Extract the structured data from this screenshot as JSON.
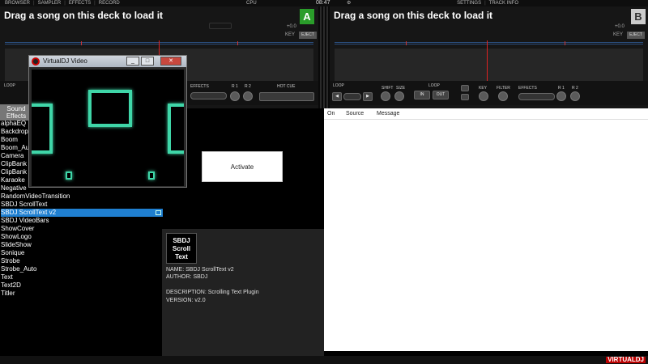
{
  "topbar": {
    "menu": [
      "BROWSER",
      "SAMPLER",
      "EFFECTS",
      "RECORD"
    ],
    "cpu_label": "CPU",
    "time": "08:47",
    "settings": "SETTINGS",
    "track_info": "TRACK INFO"
  },
  "deck_a": {
    "title": "Drag a song on this deck to load it",
    "letter": "A",
    "pitch": "+0.0",
    "key_label": "KEY",
    "eject": "EJECT"
  },
  "deck_b": {
    "title": "Drag a song on this deck to load it",
    "letter": "B",
    "pitch": "+0.0",
    "key_label": "KEY",
    "eject": "EJECT"
  },
  "controls_left": {
    "loop": "LOOP",
    "effects": "EFFECTS",
    "knob_r1": "R 1",
    "knob_r2": "R 2",
    "hot_cue": "HOT CUE"
  },
  "controls_right": {
    "loop": "LOOP",
    "shift": "SHIFT",
    "size": "SIZE",
    "loop2": "LOOP",
    "in": "IN",
    "out": "OUT",
    "key": "KEY",
    "filter": "FILTER",
    "effects": "EFFECTS",
    "knob_r1": "R 1",
    "knob_r2": "R 2"
  },
  "video_window": {
    "title": "VirtualDJ Video",
    "minimize": "_",
    "maximize": "□",
    "close": "✕"
  },
  "sidebar": {
    "sound_effects_line1": "Sound",
    "sound_effects_line2": "Effects"
  },
  "effects": [
    "alphaEQ",
    "Backdrop",
    "Boom",
    "Boom_Auto",
    "Camera",
    "ClipBank",
    "ClipBank",
    "Karaoke",
    "Negative",
    "RandomVideoTransition",
    "SBDJ ScrollText",
    "SBDJ ScrollText v2",
    "SBDJ VideoBars",
    "ShowCover",
    "ShowLogo",
    "SlideShow",
    "Sonique",
    "Strobe",
    "Strobe_Auto",
    "Text",
    "Text2D",
    "Titler"
  ],
  "selected_effect_index": 11,
  "activate_button": "Activate",
  "info": {
    "thumb_line1": "SBDJ",
    "thumb_line2": "Scroll",
    "thumb_line3": "Text",
    "name": "NAME: SBDJ ScrollText v2",
    "author": "AUTHOR: SBDJ",
    "description": "DESCRIPTION: Scrolling Text Plugin",
    "version": "VERSION: v2.0"
  },
  "log": {
    "col_on": "On",
    "col_source": "Source",
    "col_message": "Message"
  },
  "logo": "VIRTUALDJ",
  "colors": {
    "deck_a_accent": "#2a9d2a",
    "selection": "#1f7fd0",
    "video_shapes": "#3fd6a8",
    "cue_line": "#dd2222"
  }
}
